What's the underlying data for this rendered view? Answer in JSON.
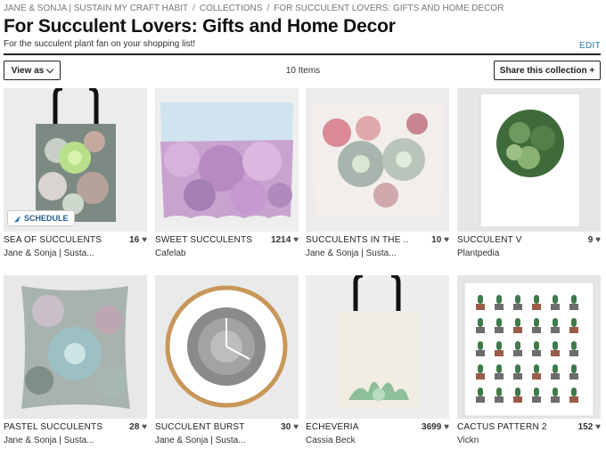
{
  "breadcrumb": {
    "user": "JANE & SONJA | SUSTAIN MY CRAFT HABIT",
    "section": "COLLECTIONS",
    "current": "FOR SUCCULENT LOVERS: GIFTS AND HOME DECOR"
  },
  "title": "For Succulent Lovers: Gifts and Home Decor",
  "subtitle": "For the succulent plant fan on your shopping list!",
  "edit_label": "EDIT",
  "toolbar": {
    "view_as_label": "View as",
    "item_count": "10 Items",
    "share_label": "Share this collection +"
  },
  "schedule_label": "SCHEDULE",
  "items": [
    {
      "name": "SEA OF SUCCULENTS",
      "count": "16",
      "artist": "Jane & Sonja | Susta...",
      "product": "tote bag"
    },
    {
      "name": "SWEET SUCCULENTS",
      "count": "1214",
      "artist": "Cafelab",
      "product": "tapestry"
    },
    {
      "name": "SUCCULENTS IN THE ...",
      "count": "10",
      "artist": "Jane & Sonja | Susta...",
      "product": "tapestry"
    },
    {
      "name": "SUCCULENT V",
      "count": "9",
      "artist": "Plantpedia",
      "product": "art print"
    },
    {
      "name": "PASTEL SUCCULENTS ...",
      "count": "28",
      "artist": "Jane & Sonja | Susta...",
      "product": "throw pillow"
    },
    {
      "name": "SUCCULENT BURST",
      "count": "30",
      "artist": "Jane & Sonja | Susta...",
      "product": "wall clock"
    },
    {
      "name": "ECHEVERIA",
      "count": "3699",
      "artist": "Cassia Beck",
      "product": "tote bag"
    },
    {
      "name": "CACTUS PATTERN 2",
      "count": "152",
      "artist": "Vickn",
      "product": "art print"
    }
  ],
  "colors": {
    "link": "#2a7ab0",
    "divider": "#222222",
    "schedule_text": "#2a5d8a"
  }
}
